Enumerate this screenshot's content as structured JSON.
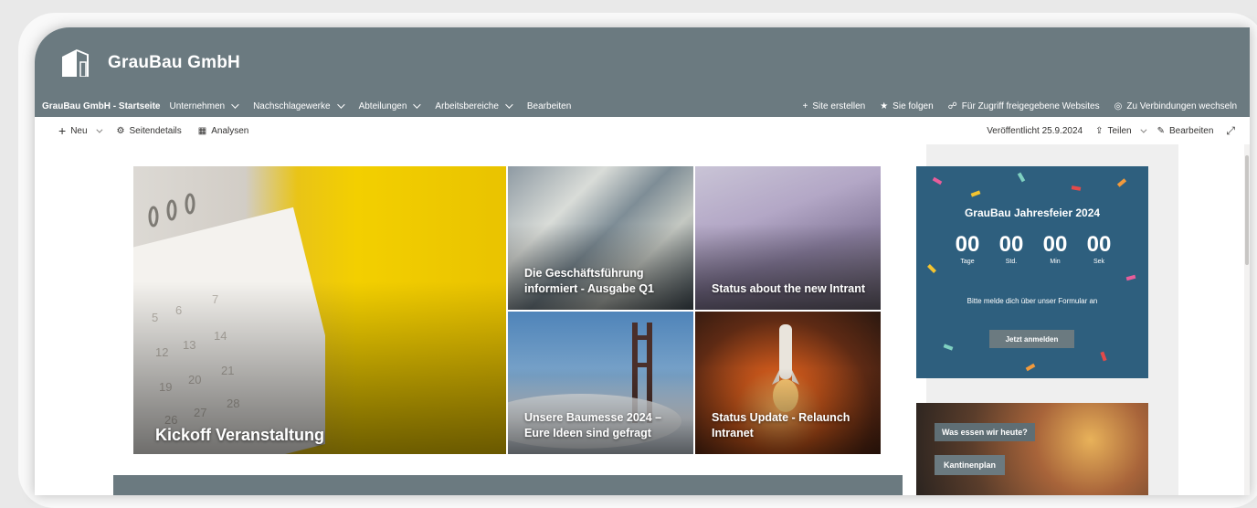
{
  "site": {
    "name": "GrauBau GmbH"
  },
  "nav": {
    "home": "GrauBau GmbH - Startseite",
    "items": [
      "Unternehmen",
      "Nachschlagewerke",
      "Abteilungen",
      "Arbeitsbereiche"
    ],
    "edit": "Bearbeiten",
    "right": [
      "Site erstellen",
      "Sie folgen",
      "Für Zugriff freigegebene Websites",
      "Zu Verbindungen wechseln"
    ]
  },
  "commands": {
    "new": "Neu",
    "page_details": "Seitendetails",
    "analytics": "Analysen",
    "published": "Veröffentlicht 25.9.2024",
    "share": "Teilen",
    "edit": "Bearbeiten"
  },
  "hero": {
    "main": "Kickoff Veranstaltung",
    "tiles": [
      "Die Geschäftsführung informiert - Ausgabe Q1",
      "Status about the new Intrant",
      "Unsere Baumesse 2024 – Eure Ideen sind gefragt",
      "Status Update - Relaunch Intranet"
    ]
  },
  "event": {
    "title": "GrauBau Jahresfeier 2024",
    "counter": [
      {
        "value": "00",
        "label": "Tage"
      },
      {
        "value": "00",
        "label": "Std."
      },
      {
        "value": "00",
        "label": "Min"
      },
      {
        "value": "00",
        "label": "Sek"
      }
    ],
    "note": "Bitte melde dich über unser Formular an",
    "button": "Jetzt anmelden"
  },
  "food": {
    "question": "Was essen wir heute?",
    "button": "Kantinenplan"
  },
  "colors": {
    "brand": "#6b7a80",
    "event_bg": "#2e5f7e"
  },
  "icons": [
    "plus-icon",
    "gear-icon",
    "analytics-icon",
    "share-icon",
    "pencil-icon",
    "expand-icon",
    "star-icon",
    "people-icon",
    "connections-icon"
  ]
}
